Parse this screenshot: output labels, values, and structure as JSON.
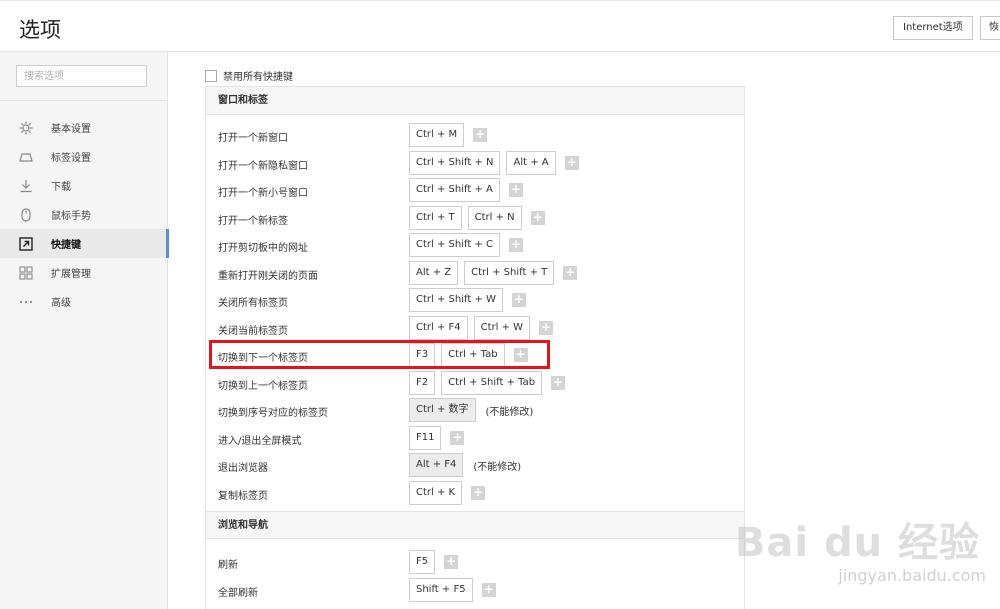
{
  "header": {
    "title": "选项",
    "internet_options_label": "Internet选项",
    "restore_label": "恢"
  },
  "sidebar": {
    "search_placeholder": "搜索选项",
    "items": [
      {
        "label": "基本设置",
        "icon": "gear-icon"
      },
      {
        "label": "标签设置",
        "icon": "tab-icon"
      },
      {
        "label": "下载",
        "icon": "download-icon"
      },
      {
        "label": "鼠标手势",
        "icon": "mouse-icon"
      },
      {
        "label": "快捷键",
        "icon": "shortcut-icon",
        "active": true
      },
      {
        "label": "扩展管理",
        "icon": "extensions-icon"
      },
      {
        "label": "高级",
        "icon": "more-icon"
      }
    ]
  },
  "main": {
    "disable_all_label": "禁用所有快捷键",
    "sections": [
      {
        "title": "窗口和标签",
        "rows": [
          {
            "label": "打开一个新窗口",
            "keys": [
              "Ctrl + M"
            ]
          },
          {
            "label": "打开一个新隐私窗口",
            "keys": [
              "Ctrl + Shift + N",
              "Alt + A"
            ]
          },
          {
            "label": "打开一个新小号窗口",
            "keys": [
              "Ctrl + Shift + A"
            ]
          },
          {
            "label": "打开一个新标签",
            "keys": [
              "Ctrl + T",
              "Ctrl + N"
            ]
          },
          {
            "label": "打开剪切板中的网址",
            "keys": [
              "Ctrl + Shift + C"
            ]
          },
          {
            "label": "重新打开刚关闭的页面",
            "keys": [
              "Alt + Z",
              "Ctrl + Shift + T"
            ]
          },
          {
            "label": "关闭所有标签页",
            "keys": [
              "Ctrl + Shift + W"
            ]
          },
          {
            "label": "关闭当前标签页",
            "keys": [
              "Ctrl + F4",
              "Ctrl + W"
            ]
          },
          {
            "label": "切换到下一个标签页",
            "keys": [
              "F3",
              "Ctrl + Tab"
            ]
          },
          {
            "label": "切换到上一个标签页",
            "keys": [
              "F2",
              "Ctrl + Shift + Tab"
            ]
          },
          {
            "label": "切换到序号对应的标签页",
            "keys": [
              "Ctrl + 数字"
            ],
            "fixed": true,
            "note": "(不能修改)"
          },
          {
            "label": "进入/退出全屏模式",
            "keys": [
              "F11"
            ]
          },
          {
            "label": "退出浏览器",
            "keys": [
              "Alt + F4"
            ],
            "fixed": true,
            "note": "(不能修改)"
          },
          {
            "label": "复制标签页",
            "keys": [
              "Ctrl + K"
            ]
          }
        ]
      },
      {
        "title": "浏览和导航",
        "rows": [
          {
            "label": "刷新",
            "keys": [
              "F5"
            ]
          },
          {
            "label": "全部刷新",
            "keys": [
              "Shift + F5"
            ]
          }
        ]
      }
    ],
    "add_symbol": "+"
  },
  "watermark": {
    "brand": "Bai du 经验",
    "url": "jingyan.baidu.com"
  },
  "colors": {
    "highlight": "#e4141c",
    "active_indicator": "#5a8fd6"
  }
}
